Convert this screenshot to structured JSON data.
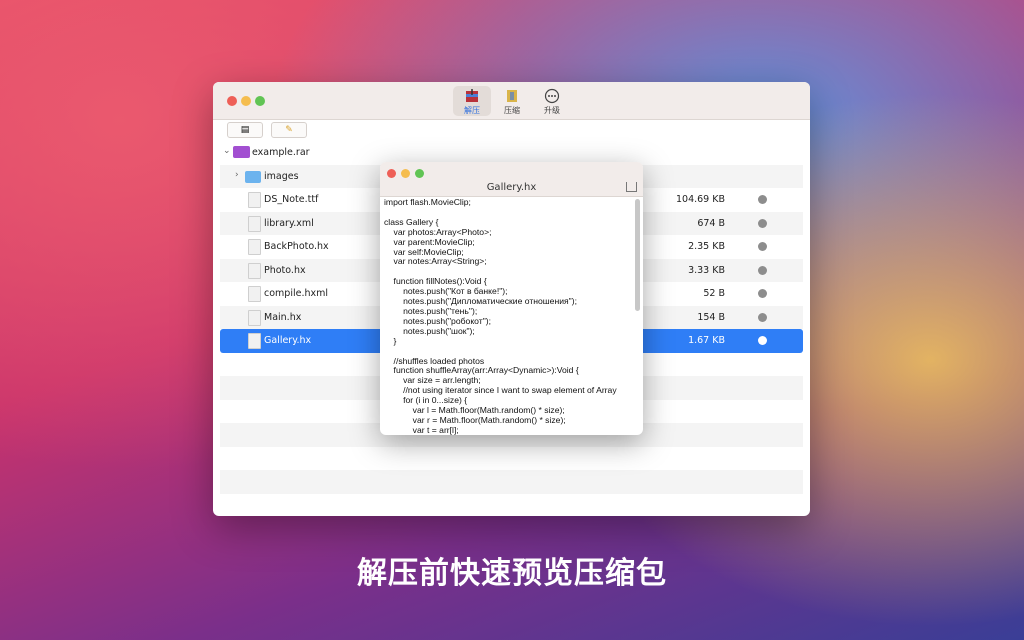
{
  "window": {
    "tabs": [
      {
        "label": "解压",
        "icon": "extract-icon",
        "active": true
      },
      {
        "label": "压缩",
        "icon": "compress-icon",
        "active": false
      },
      {
        "label": "升级",
        "icon": "more-icon",
        "active": false
      }
    ],
    "archive_name": "example.rar",
    "files": [
      {
        "name": "images",
        "size": "",
        "type": "folder"
      },
      {
        "name": "DS_Note.ttf",
        "size": "104.69 KB",
        "type": "font"
      },
      {
        "name": "library.xml",
        "size": "674 B",
        "type": "xml"
      },
      {
        "name": "BackPhoto.hx",
        "size": "2.35 KB",
        "type": "file"
      },
      {
        "name": "Photo.hx",
        "size": "3.33 KB",
        "type": "file"
      },
      {
        "name": "compile.hxml",
        "size": "52 B",
        "type": "file"
      },
      {
        "name": "Main.hx",
        "size": "154 B",
        "type": "file"
      },
      {
        "name": "Gallery.hx",
        "size": "1.67 KB",
        "type": "file",
        "selected": true
      }
    ]
  },
  "preview": {
    "title": "Gallery.hx",
    "code": "import flash.MovieClip;\n\nclass Gallery {\n    var photos:Array<Photo>;\n    var parent:MovieClip;\n    var self:MovieClip;\n    var notes:Array<String>;\n\n    function fillNotes():Void {\n        notes.push(\"Кот в банке!\");\n        notes.push(\"Дипломатические отношения\");\n        notes.push(\"тень\");\n        notes.push(\"робокот\");\n        notes.push(\"шок\");\n    }\n\n    //shuffles loaded photos\n    function shuffleArray(arr:Array<Dynamic>):Void {\n        var size = arr.length;\n        //not using iterator since I want to swap element of Array\n        for (i in 0...size) {\n            var l = Math.floor(Math.random() * size);\n            var r = Math.floor(Math.random() * size);\n            var t = arr[l];"
  },
  "caption": "解压前快速预览压缩包",
  "colors": {
    "accent": "#2f7ef6"
  }
}
